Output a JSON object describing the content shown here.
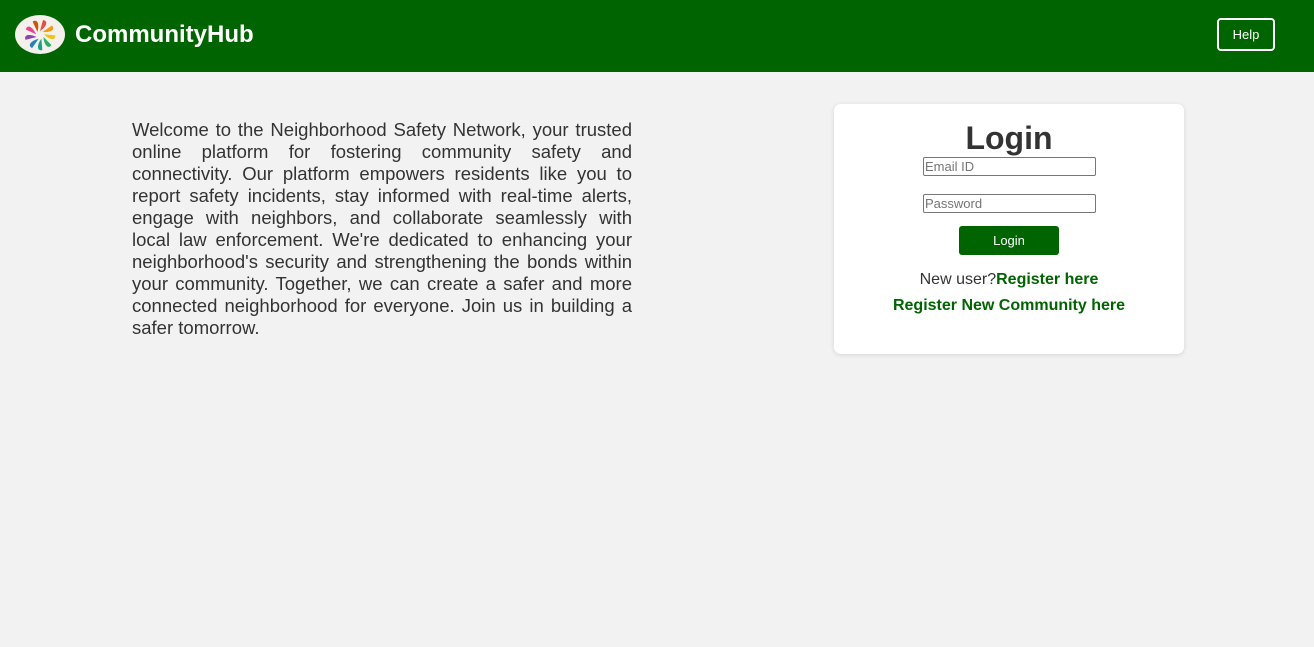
{
  "header": {
    "brand": "CommunityHub",
    "help_label": "Help",
    "logo_icon": "colorful-pinwheel-icon",
    "background_color": "#006400"
  },
  "intro": {
    "text": "Welcome to the Neighborhood Safety Network, your trusted online platform for fostering community safety and connectivity. Our platform empowers residents like you to report safety incidents, stay informed with real-time alerts, engage with neighbors, and collaborate seamlessly with local law enforcement. We're dedicated to enhancing your neighborhood's security and strengthening the bonds within your community. Together, we can create a safer and more connected neighborhood for everyone. Join us in building a safer tomorrow."
  },
  "login": {
    "title": "Login",
    "email_placeholder": "Email ID",
    "password_placeholder": "Password",
    "button_label": "Login",
    "new_user_prefix": "New user?",
    "register_link": "Register here",
    "register_community_link": "Register New Community here",
    "accent_color": "#006400"
  }
}
